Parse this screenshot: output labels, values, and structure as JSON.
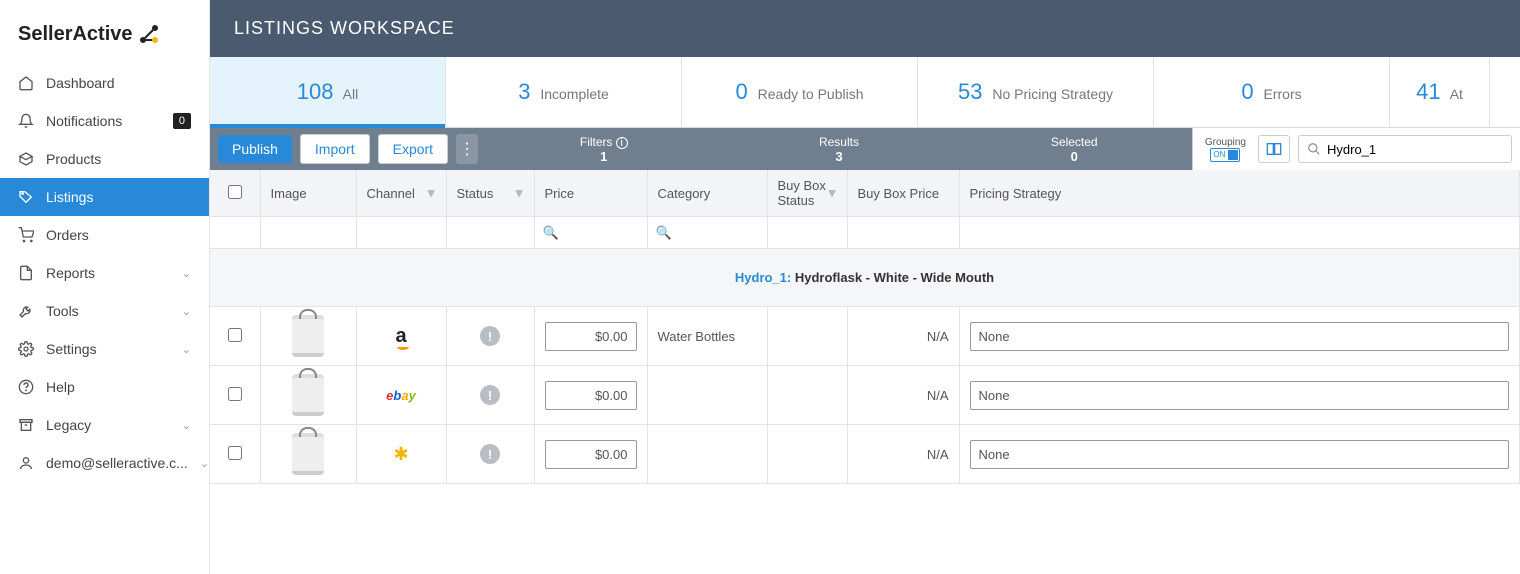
{
  "brand": "SellerActive",
  "nav": {
    "dashboard": "Dashboard",
    "notifications": "Notifications",
    "notifications_badge": "0",
    "products": "Products",
    "listings": "Listings",
    "orders": "Orders",
    "reports": "Reports",
    "tools": "Tools",
    "settings": "Settings",
    "help": "Help",
    "legacy": "Legacy",
    "user": "demo@selleractive.c..."
  },
  "header": {
    "title": "LISTINGS WORKSPACE"
  },
  "tabs": {
    "all": {
      "count": "108",
      "label": "All"
    },
    "incomplete": {
      "count": "3",
      "label": "Incomplete"
    },
    "ready": {
      "count": "0",
      "label": "Ready to Publish"
    },
    "nopricing": {
      "count": "53",
      "label": "No Pricing Strategy"
    },
    "errors": {
      "count": "0",
      "label": "Errors"
    },
    "att": {
      "count": "41",
      "label": "At"
    }
  },
  "toolbar": {
    "publish": "Publish",
    "import": "Import",
    "export": "Export",
    "filters_label": "Filters",
    "filters_val": "1",
    "results_label": "Results",
    "results_val": "3",
    "selected_label": "Selected",
    "selected_val": "0",
    "grouping_label": "Grouping",
    "grouping_state": "ON",
    "search_value": "Hydro_1"
  },
  "columns": {
    "image": "Image",
    "channel": "Channel",
    "status": "Status",
    "price": "Price",
    "category": "Category",
    "buybox_status": "Buy Box Status",
    "buybox_price": "Buy Box Price",
    "pricing_strategy": "Pricing Strategy"
  },
  "group": {
    "sku": "Hydro_1:",
    "title": "Hydroflask - White - Wide Mouth"
  },
  "rows": [
    {
      "channel": "amazon",
      "price": "$0.00",
      "category": "Water Bottles",
      "bb_price": "N/A",
      "strategy": "None"
    },
    {
      "channel": "ebay",
      "price": "$0.00",
      "category": "",
      "bb_price": "N/A",
      "strategy": "None"
    },
    {
      "channel": "walmart",
      "price": "$0.00",
      "category": "",
      "bb_price": "N/A",
      "strategy": "None"
    }
  ]
}
